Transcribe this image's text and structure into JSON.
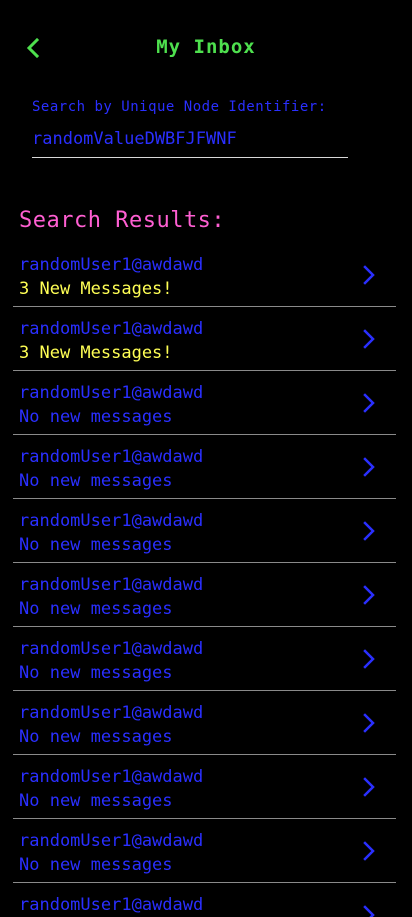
{
  "colors": {
    "background": "#000000",
    "green": "#4ee04e",
    "blue": "#2a2fff",
    "pink": "#ff5fd2",
    "yellow": "#ffff55",
    "divider": "#8a8a8a"
  },
  "header": {
    "back_icon": "chevron-left-icon",
    "title": "My Inbox"
  },
  "search": {
    "label": "Search by Unique Node Identifier:",
    "value": "randomValueDWBFJFWNF"
  },
  "results": {
    "title": "Search Results:",
    "chevron_icon": "chevron-right-icon",
    "items": [
      {
        "user": "randomUser1@awdawd",
        "status": "3 New Messages!",
        "has_new": true
      },
      {
        "user": "randomUser1@awdawd",
        "status": "3 New Messages!",
        "has_new": true
      },
      {
        "user": "randomUser1@awdawd",
        "status": "No new messages",
        "has_new": false
      },
      {
        "user": "randomUser1@awdawd",
        "status": "No new messages",
        "has_new": false
      },
      {
        "user": "randomUser1@awdawd",
        "status": "No new messages",
        "has_new": false
      },
      {
        "user": "randomUser1@awdawd",
        "status": "No new messages",
        "has_new": false
      },
      {
        "user": "randomUser1@awdawd",
        "status": "No new messages",
        "has_new": false
      },
      {
        "user": "randomUser1@awdawd",
        "status": "No new messages",
        "has_new": false
      },
      {
        "user": "randomUser1@awdawd",
        "status": "No new messages",
        "has_new": false
      },
      {
        "user": "randomUser1@awdawd",
        "status": "No new messages",
        "has_new": false
      },
      {
        "user": "randomUser1@awdawd",
        "status": "",
        "has_new": false
      }
    ]
  }
}
